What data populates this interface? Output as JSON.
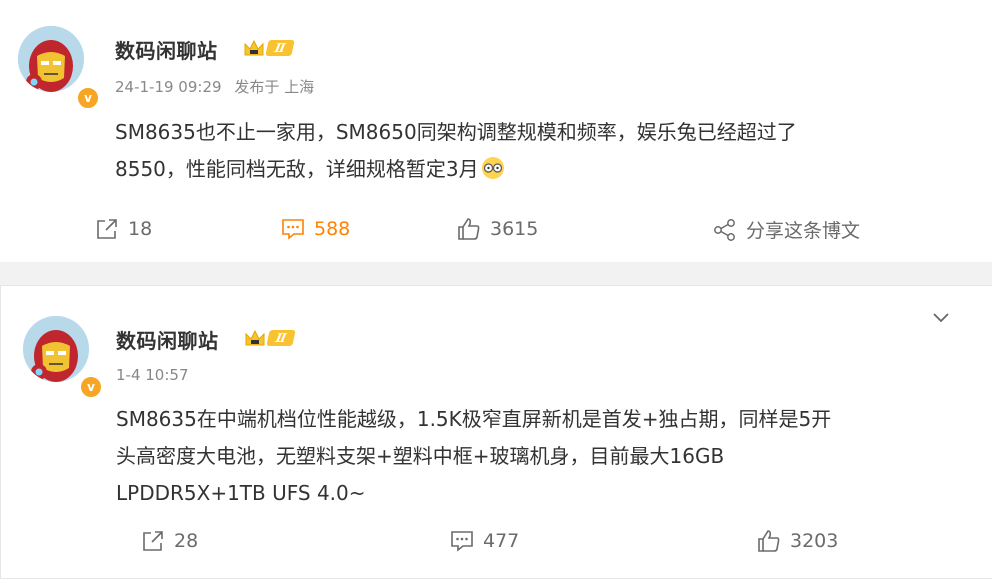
{
  "posts": [
    {
      "username": "数码闲聊站",
      "vip_level": "Ⅱ",
      "verified_badge": "v",
      "date": "24-1-19 09:29",
      "source": "发布于 上海",
      "content_lines": [
        "SM8635也不止一家用，SM8650同架构调整规模和频率，娱乐兔已经超过了",
        "8550，性能同档无敌，详细规格暂定3月"
      ],
      "emoji_icon": "glasses-emoji",
      "repost_count": "18",
      "comment_count": "588",
      "like_count": "3615",
      "share_label": "分享这条博文"
    },
    {
      "username": "数码闲聊站",
      "vip_level": "Ⅱ",
      "verified_badge": "v",
      "date": "1-4 10:57",
      "content_lines": [
        "SM8635在中端机档位性能越级，1.5K极窄直屏新机是首发+独占期，同样是5开",
        "头高密度大电池，无塑料支架+塑料中框+玻璃机身，目前最大16GB",
        "LPDDR5X+1TB UFS 4.0~"
      ],
      "repost_count": "28",
      "comment_count": "477",
      "like_count": "3203"
    }
  ],
  "colors": {
    "accent": "#ff8200",
    "vip_gold": "#f8c230",
    "text": "#333333",
    "muted": "#888888"
  }
}
